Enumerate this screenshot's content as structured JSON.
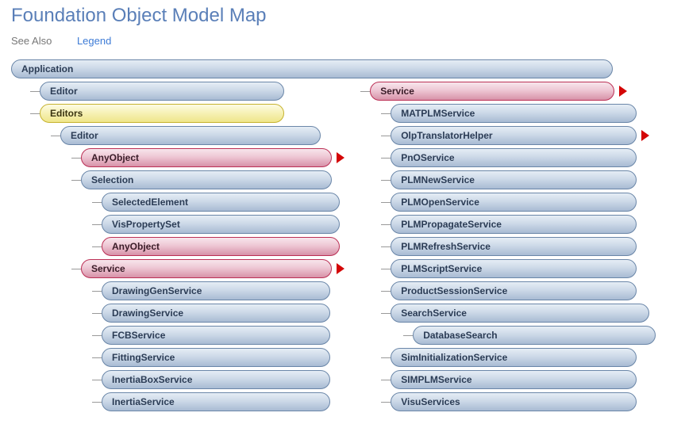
{
  "header": {
    "title": "Foundation Object Model Map",
    "see_also": "See Also",
    "legend": "Legend"
  },
  "tree": {
    "application": "Application",
    "editor1": "Editor",
    "editors": "Editors",
    "editor2": "Editor",
    "anyobject1": "AnyObject",
    "selection": "Selection",
    "selectedelement": "SelectedElement",
    "vispropertyset": "VisPropertySet",
    "anyobject2": "AnyObject",
    "service_left": "Service",
    "drawinggen": "DrawingGenService",
    "drawing": "DrawingService",
    "fcb": "FCBService",
    "fitting": "FittingService",
    "inertiabox": "InertiaBoxService",
    "inertia": "InertiaService"
  },
  "right": {
    "service": "Service",
    "matplm": "MATPLMService",
    "olp": "OlpTranslatorHelper",
    "pno": "PnOService",
    "plmnew": "PLMNewService",
    "plmopen": "PLMOpenService",
    "plmprop": "PLMPropagateService",
    "plmrefresh": "PLMRefreshService",
    "plmscript": "PLMScriptService",
    "prodsess": "ProductSessionService",
    "search": "SearchService",
    "dbsearch": "DatabaseSearch",
    "siminit": "SimInitializationService",
    "simplm": "SIMPLMService",
    "visu": "VisuServices"
  }
}
